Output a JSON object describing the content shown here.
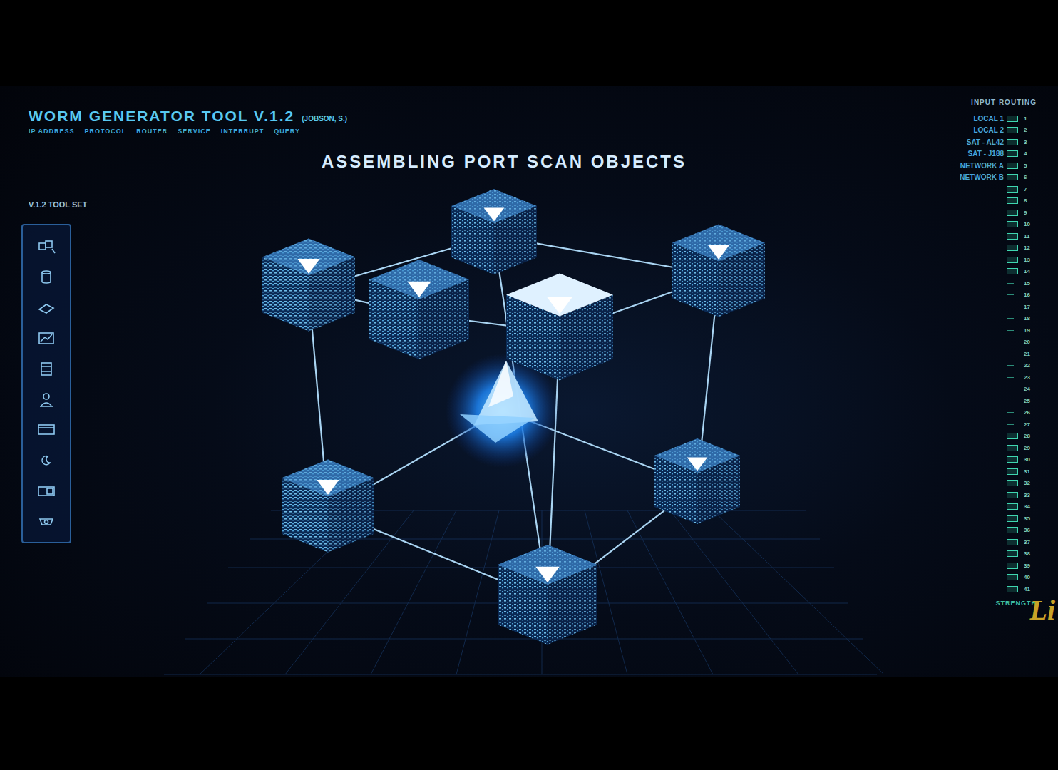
{
  "window": {
    "title": "WORM GENERATOR TOOL V.1.2",
    "author": "(JOBSON, S.)"
  },
  "menu": [
    "IP ADDRESS",
    "PROTOCOL",
    "ROUTER",
    "SERVICE",
    "INTERRUPT",
    "QUERY"
  ],
  "status": "ASSEMBLING PORT SCAN OBJECTS",
  "toolbar": {
    "title": "V.1.2 TOOL SET"
  },
  "routing": {
    "title": "INPUT ROUTING",
    "inputs": [
      "LOCAL 1",
      "LOCAL 2",
      "SAT - AL42",
      "SAT - J188",
      "NETWORK A",
      "NETWORK B"
    ],
    "scale": [
      {
        "label": "1",
        "lit": true
      },
      {
        "label": "2",
        "lit": true
      },
      {
        "label": "3",
        "lit": true
      },
      {
        "label": "4",
        "lit": true
      },
      {
        "label": "5",
        "lit": true
      },
      {
        "label": "6",
        "lit": true
      },
      {
        "label": "7",
        "lit": true
      },
      {
        "label": "8",
        "lit": true
      },
      {
        "label": "9",
        "lit": true
      },
      {
        "label": "10",
        "lit": true
      },
      {
        "label": "11",
        "lit": true
      },
      {
        "label": "12",
        "lit": true
      },
      {
        "label": "13",
        "lit": true
      },
      {
        "label": "14",
        "lit": true
      },
      {
        "label": "15",
        "lit": false
      },
      {
        "label": "16",
        "lit": false
      },
      {
        "label": "17",
        "lit": false
      },
      {
        "label": "18",
        "lit": false
      },
      {
        "label": "19",
        "lit": false
      },
      {
        "label": "20",
        "lit": false
      },
      {
        "label": "21",
        "lit": false
      },
      {
        "label": "22",
        "lit": false
      },
      {
        "label": "23",
        "lit": false
      },
      {
        "label": "24",
        "lit": false
      },
      {
        "label": "25",
        "lit": false
      },
      {
        "label": "26",
        "lit": false
      },
      {
        "label": "27",
        "lit": false
      },
      {
        "label": "28",
        "lit": true
      },
      {
        "label": "29",
        "lit": true
      },
      {
        "label": "30",
        "lit": true
      },
      {
        "label": "31",
        "lit": true
      },
      {
        "label": "32",
        "lit": true
      },
      {
        "label": "33",
        "lit": true
      },
      {
        "label": "34",
        "lit": true
      },
      {
        "label": "35",
        "lit": true
      },
      {
        "label": "36",
        "lit": true
      },
      {
        "label": "37",
        "lit": true
      },
      {
        "label": "38",
        "lit": true
      },
      {
        "label": "39",
        "lit": true
      },
      {
        "label": "40",
        "lit": true
      },
      {
        "label": "41",
        "lit": true
      }
    ],
    "caption": "STRENGTH"
  },
  "diagram": {
    "nodes": [
      {
        "kind": "cube",
        "highlighted": false
      },
      {
        "kind": "cube",
        "highlighted": false
      },
      {
        "kind": "cube",
        "highlighted": false
      },
      {
        "kind": "cube",
        "highlighted": false
      },
      {
        "kind": "cube",
        "highlighted": true
      },
      {
        "kind": "cube",
        "highlighted": false
      },
      {
        "kind": "cube",
        "highlighted": false
      },
      {
        "kind": "cube",
        "highlighted": false
      },
      {
        "kind": "core",
        "highlighted": true
      }
    ],
    "edges": [
      {
        "from": 1,
        "to": 0
      },
      {
        "from": 0,
        "to": 2
      },
      {
        "from": 1,
        "to": 3
      },
      {
        "from": 3,
        "to": 4
      },
      {
        "from": 2,
        "to": 4
      },
      {
        "from": 1,
        "to": 5
      },
      {
        "from": 0,
        "to": 7
      },
      {
        "from": 2,
        "to": 6
      },
      {
        "from": 5,
        "to": 7
      },
      {
        "from": 7,
        "to": 6
      },
      {
        "from": 5,
        "to": 8
      },
      {
        "from": 8,
        "to": 6
      },
      {
        "from": 4,
        "to": 7
      }
    ]
  },
  "watermark": "Li"
}
